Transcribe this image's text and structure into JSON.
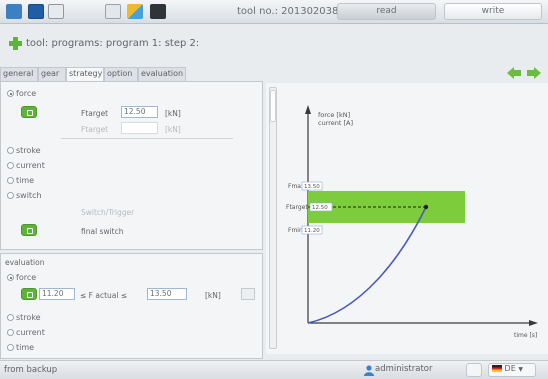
{
  "toolbar": {
    "tool_label": "tool no.: 201302038",
    "read_label": "read",
    "write_label": "write",
    "icons": [
      "save-icon",
      "floppy-icon",
      "user-icon",
      "settings-icon",
      "brand-logo-icon",
      "lock-icon"
    ]
  },
  "breadcrumb": {
    "text": "tool: programs: program 1: step 2:"
  },
  "tabs": [
    "general",
    "gear",
    "strategy",
    "option",
    "evaluation"
  ],
  "strategy": {
    "force_label": "force",
    "ftarget_label": "Ftarget",
    "ftarget_value": "12.50",
    "ftarget_unit": "[kN]",
    "ftarget2_label": "Ftarget",
    "ftarget2_unit": "[kN]",
    "options": [
      "stroke",
      "current",
      "time",
      "switch"
    ],
    "switch_label": "Switch/Trigger",
    "final_switch_label": "final switch"
  },
  "evaluation": {
    "title": "evaluation",
    "force_label": "force",
    "min_value": "11.20",
    "compare_label": "≤ F actual ≤",
    "max_value": "13.50",
    "unit": "[kN]",
    "options": [
      "stroke",
      "current",
      "time"
    ]
  },
  "chart": {
    "y_label_1": "force [kN]",
    "y_label_2": "current [A]",
    "fmax_label": "Fmax",
    "fmax_value": "13.50",
    "ftarget_label": "Ftarget",
    "ftarget_value": "12.50",
    "fmin_label": "Fmin",
    "fmin_value": "11.20",
    "x_label": "time [s]"
  },
  "status": {
    "left": "from backup",
    "user": "administrator",
    "language": "DE"
  },
  "colors": {
    "accent_green": "#7ccc3b",
    "curve": "#4a5bbd"
  }
}
